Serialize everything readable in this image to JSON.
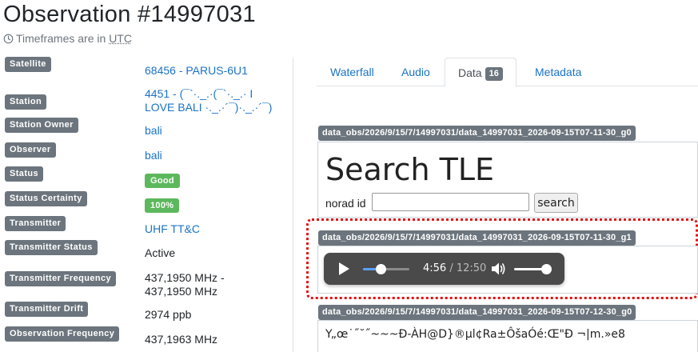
{
  "page": {
    "title": "Observation #14997031",
    "subtitle_prefix": "Timeframes are in ",
    "subtitle_tz": "UTC"
  },
  "details": {
    "satellite_label": "Satellite",
    "satellite_value": "68456 - PARUS-6U1",
    "station_label": "Station",
    "station_value_line1": "4451 - (¯`·._.·(¯`·._.· I",
    "station_value_line2": "LOVE BALI ·._.·´¯)·._.·´¯)",
    "station_owner_label": "Station Owner",
    "station_owner_value": "bali",
    "observer_label": "Observer",
    "observer_value": "bali",
    "status_label": "Status",
    "status_value": "Good",
    "status_certainty_label": "Status Certainty",
    "status_certainty_value": "100%",
    "transmitter_label": "Transmitter",
    "transmitter_value": "UHF TT&C",
    "transmitter_status_label": "Transmitter Status",
    "transmitter_status_value": "Active",
    "transmitter_frequency_label": "Transmitter Frequency",
    "transmitter_frequency_line1": "437,1950 MHz -",
    "transmitter_frequency_line2": "437,1950 MHz",
    "transmitter_drift_label": "Transmitter Drift",
    "transmitter_drift_value": "2974 ppb",
    "observation_frequency_label": "Observation Frequency",
    "observation_frequency_value": "437,1963 MHz"
  },
  "tabs": [
    {
      "label": "Waterfall"
    },
    {
      "label": "Audio"
    },
    {
      "label": "Data",
      "count": "16",
      "active": true
    },
    {
      "label": "Metadata"
    }
  ],
  "files": [
    {
      "name": "data_obs/2026/9/15/7/14997031/data_14997031_2026-09-15T07-11-30_g0",
      "heading": "Search TLE",
      "input_label": "norad id",
      "input_value": "",
      "button_label": "search"
    },
    {
      "name": "data_obs/2026/9/15/7/14997031/data_14997031_2026-09-15T07-11-30_g1",
      "player": {
        "current_time": "4:56",
        "separator": " / ",
        "duration": "12:50",
        "progress": 0.385,
        "volume": 1.0
      }
    },
    {
      "name": "data_obs/2026/9/15/7/14997031/data_14997031_2026-09-15T07-12-30_g0",
      "content": "Y„œ˙˝˘˝~~~Đ-ÀH@D}®µl¢Ra±ÔšaÓé:Œ\"Đ ¬|m.»e8"
    }
  ],
  "colors": {
    "label_bg": "#6c757d",
    "link": "#1a73c7",
    "good_badge": "#5cb85c",
    "highlight": "#e31010",
    "player_bg": "#4a4a4a",
    "progress_fill": "#5aa0ff"
  },
  "icons": {
    "clock": "clock-icon",
    "play": "play-icon",
    "volume": "volume-icon"
  }
}
